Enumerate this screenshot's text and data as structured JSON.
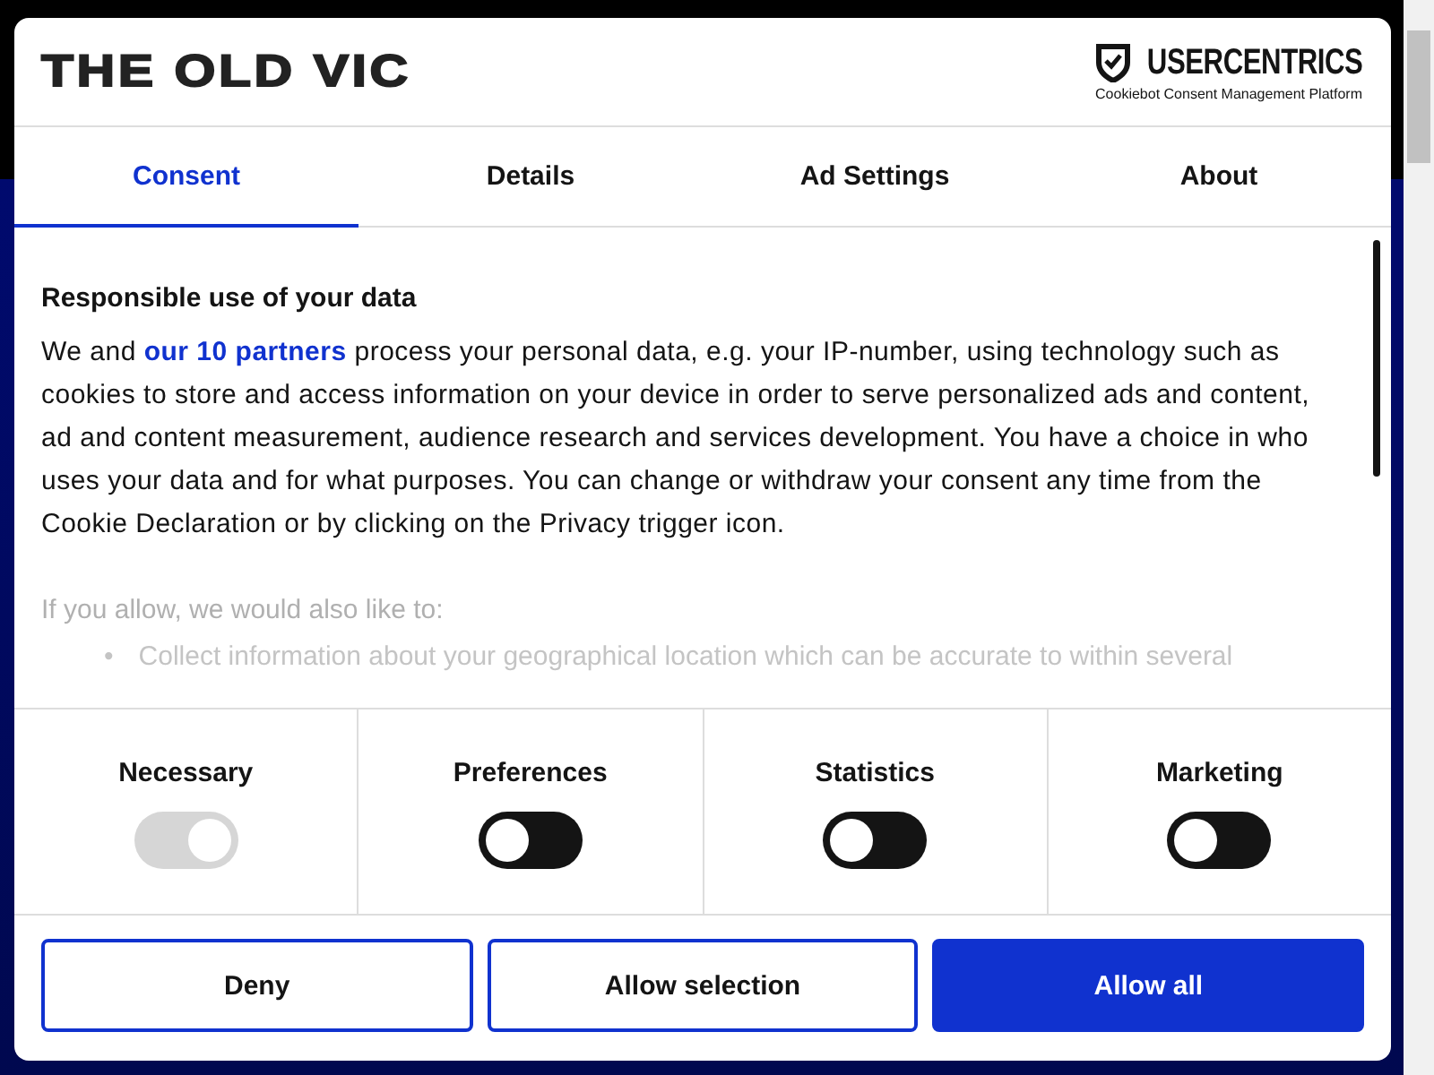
{
  "header": {
    "logo": "THE OLD VIC",
    "brand": {
      "name": "USERCENTRICS",
      "tagline": "Cookiebot Consent Management Platform"
    }
  },
  "tabs": [
    {
      "label": "Consent",
      "selected": true
    },
    {
      "label": "Details",
      "selected": false
    },
    {
      "label": "Ad Settings",
      "selected": false
    },
    {
      "label": "About",
      "selected": false
    }
  ],
  "content": {
    "heading": "Responsible use of your data",
    "intro": {
      "before": "We and ",
      "link": "our 10 partners",
      "after": " process your personal data, e.g. your IP-number, using technology such as cookies to store and access information on your device in order to serve personalized ads and content, ad and content measurement, audience research and services development. You have a choice in who uses your data and for what purposes. You can change or withdraw your consent any time from the Cookie Declaration or by clicking on the Privacy trigger icon."
    },
    "subheading": "If you allow, we would also like to:",
    "bullets": [
      {
        "marker": "•",
        "text": "Collect information about your geographical location which can be accurate to within several"
      }
    ]
  },
  "categories": [
    {
      "label": "Necessary",
      "checked": true,
      "disabled": true
    },
    {
      "label": "Preferences",
      "checked": false,
      "disabled": false
    },
    {
      "label": "Statistics",
      "checked": false,
      "disabled": false
    },
    {
      "label": "Marketing",
      "checked": false,
      "disabled": false
    }
  ],
  "buttons": [
    {
      "label": "Deny",
      "kind": "outline"
    },
    {
      "label": "Allow selection",
      "kind": "outline"
    },
    {
      "label": "Allow all",
      "kind": "primary"
    }
  ]
}
